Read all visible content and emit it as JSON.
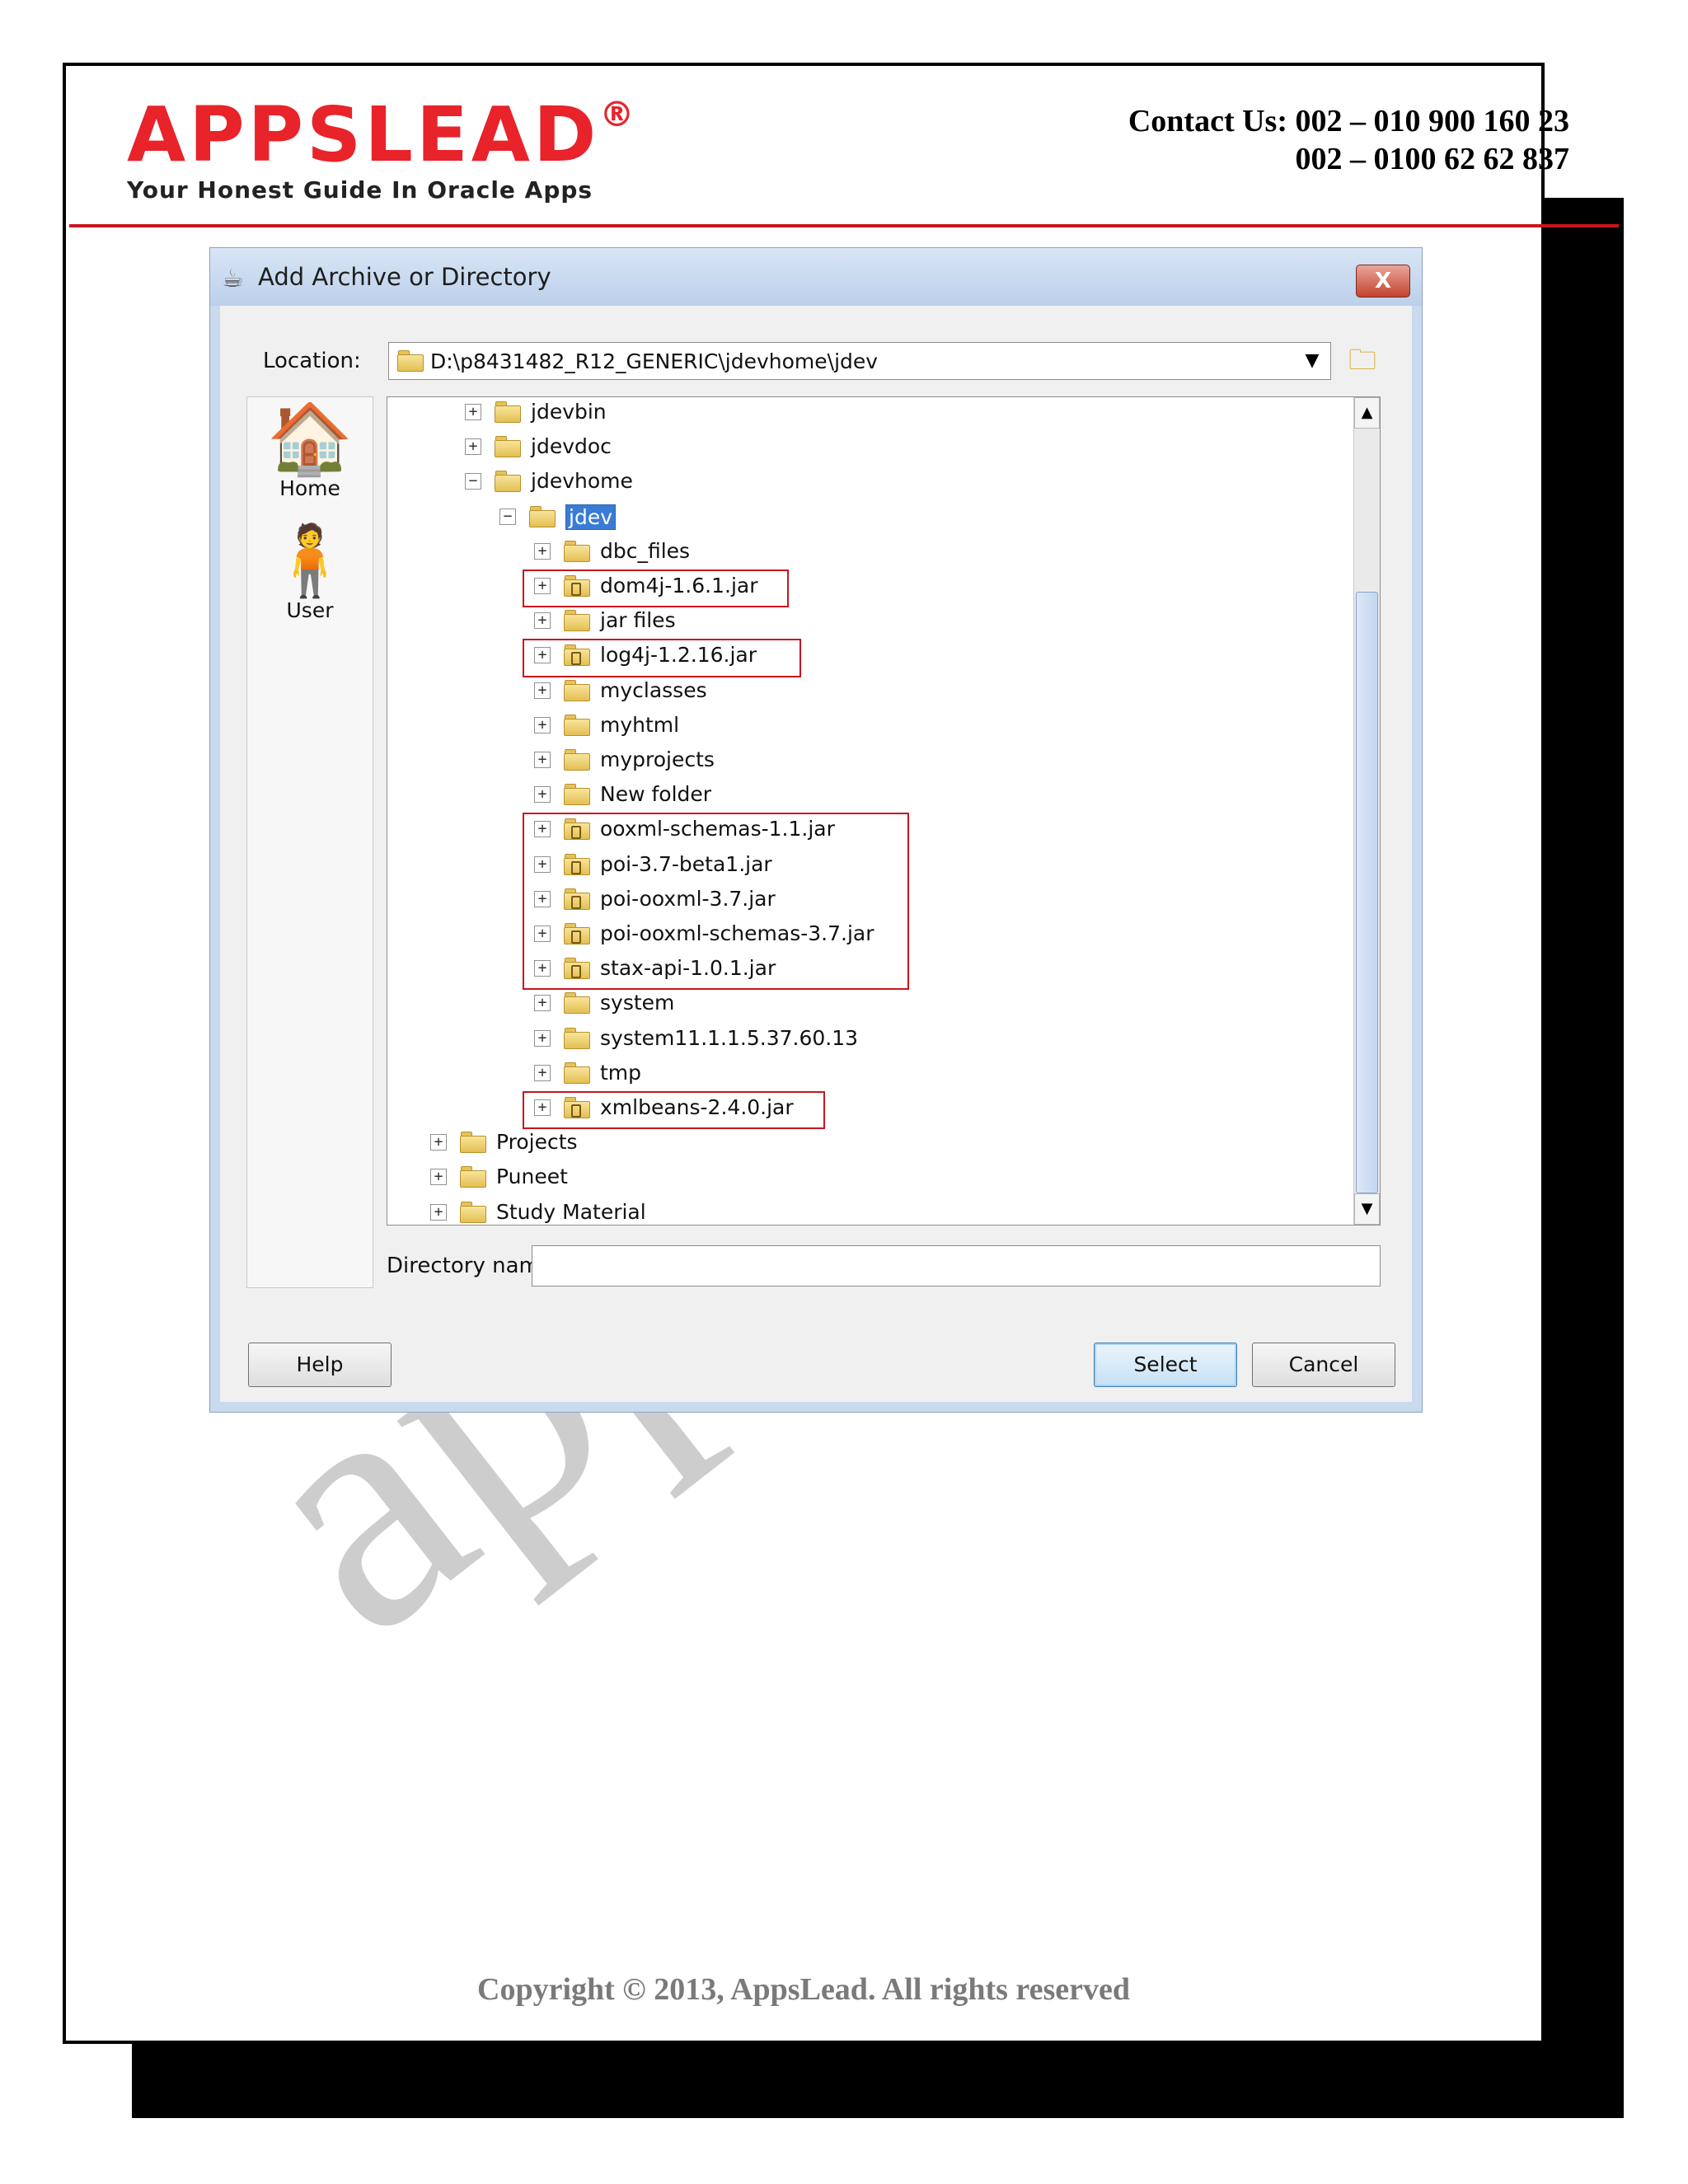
{
  "header": {
    "logo_text": "APPSLEAD",
    "logo_reg": "®",
    "tagline": "Your Honest Guide In Oracle Apps",
    "contact_line1": "Contact Us: 002 – 010 900 160 23",
    "contact_line2": "002 – 0100 62 62 837"
  },
  "watermark": "apps",
  "dialog": {
    "title": "Add Archive or Directory",
    "close_label": "X",
    "location_label": "Location:",
    "location_value": "D:\\p8431482_R12_GENERIC\\jdevhome\\jdev",
    "places": [
      {
        "label": "Home",
        "icon": "home-icon"
      },
      {
        "label": "User",
        "icon": "user-icon"
      }
    ],
    "tree": [
      {
        "label": "jdevbin",
        "level": 2,
        "expander": "+",
        "type": "folder"
      },
      {
        "label": "jdevdoc",
        "level": 2,
        "expander": "+",
        "type": "folder"
      },
      {
        "label": "jdevhome",
        "level": 2,
        "expander": "−",
        "type": "folder"
      },
      {
        "label": "jdev",
        "level": 3,
        "expander": "−",
        "type": "folder",
        "selected": true
      },
      {
        "label": "dbc_files",
        "level": 4,
        "expander": "+",
        "type": "folder"
      },
      {
        "label": "dom4j-1.6.1.jar",
        "level": 4,
        "expander": "+",
        "type": "jar"
      },
      {
        "label": "jar files",
        "level": 4,
        "expander": "+",
        "type": "folder"
      },
      {
        "label": "log4j-1.2.16.jar",
        "level": 4,
        "expander": "+",
        "type": "jar"
      },
      {
        "label": "myclasses",
        "level": 4,
        "expander": "+",
        "type": "folder"
      },
      {
        "label": "myhtml",
        "level": 4,
        "expander": "+",
        "type": "folder"
      },
      {
        "label": "myprojects",
        "level": 4,
        "expander": "+",
        "type": "folder"
      },
      {
        "label": "New folder",
        "level": 4,
        "expander": "+",
        "type": "folder"
      },
      {
        "label": "ooxml-schemas-1.1.jar",
        "level": 4,
        "expander": "+",
        "type": "jar"
      },
      {
        "label": "poi-3.7-beta1.jar",
        "level": 4,
        "expander": "+",
        "type": "jar"
      },
      {
        "label": "poi-ooxml-3.7.jar",
        "level": 4,
        "expander": "+",
        "type": "jar"
      },
      {
        "label": "poi-ooxml-schemas-3.7.jar",
        "level": 4,
        "expander": "+",
        "type": "jar"
      },
      {
        "label": "stax-api-1.0.1.jar",
        "level": 4,
        "expander": "+",
        "type": "jar"
      },
      {
        "label": "system",
        "level": 4,
        "expander": "+",
        "type": "folder"
      },
      {
        "label": "system11.1.1.5.37.60.13",
        "level": 4,
        "expander": "+",
        "type": "folder"
      },
      {
        "label": "tmp",
        "level": 4,
        "expander": "+",
        "type": "folder"
      },
      {
        "label": "xmlbeans-2.4.0.jar",
        "level": 4,
        "expander": "+",
        "type": "jar"
      },
      {
        "label": "Projects",
        "level": 1,
        "expander": "+",
        "type": "folder"
      },
      {
        "label": "Puneet",
        "level": 1,
        "expander": "+",
        "type": "folder"
      },
      {
        "label": "Study Material",
        "level": 1,
        "expander": "+",
        "type": "folder"
      }
    ],
    "directory_name_label": "Directory name:",
    "directory_name_value": "",
    "buttons": {
      "help": "Help",
      "select": "Select",
      "cancel": "Cancel"
    }
  },
  "footer": {
    "copyright": "Copyright © 2013, AppsLead. All rights reserved"
  },
  "colors": {
    "brand_red": "#e8232a",
    "rule_red": "#c8161d",
    "highlight_box": "#c8161d",
    "selection": "#3a7bd5"
  }
}
